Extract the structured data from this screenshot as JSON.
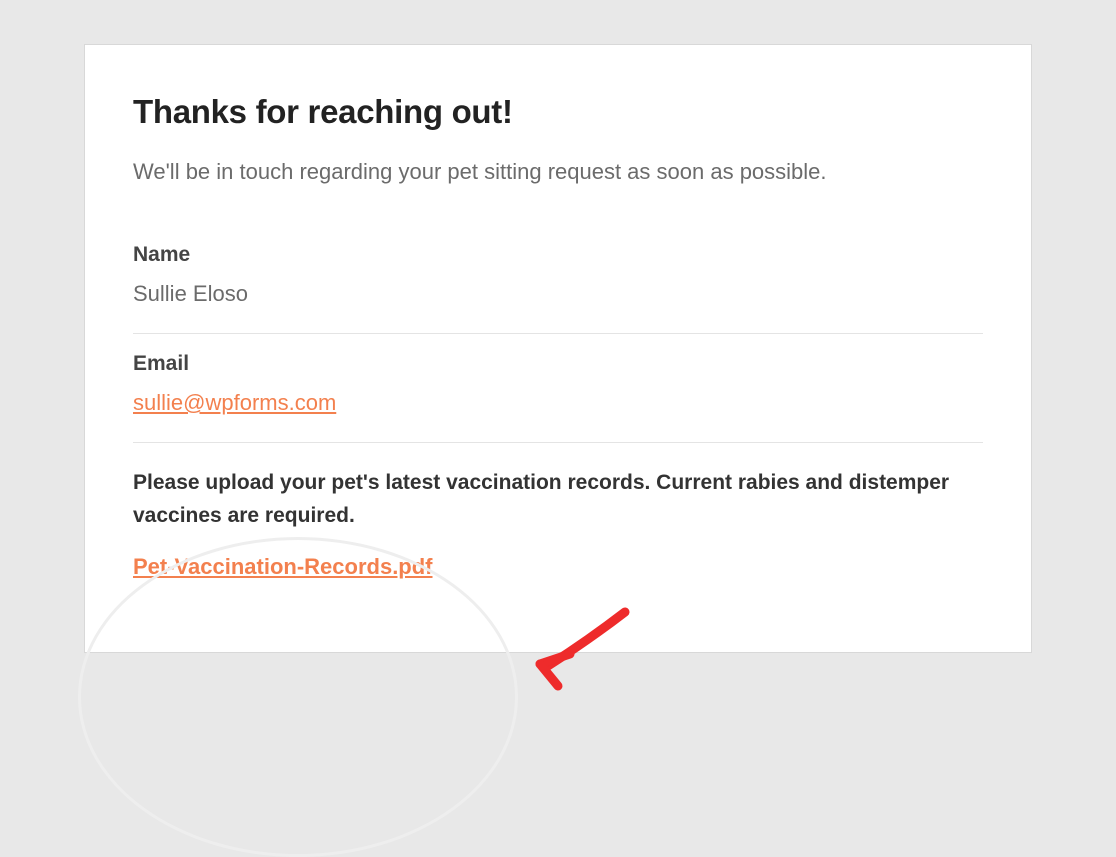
{
  "heading": "Thanks for reaching out!",
  "intro": "We'll be in touch regarding your pet sitting request as soon as possible.",
  "fields": {
    "name": {
      "label": "Name",
      "value": "Sullie Eloso"
    },
    "email": {
      "label": "Email",
      "value": "sullie@wpforms.com"
    },
    "upload": {
      "label": "Please upload your pet's latest vaccination records. Current rabies and distemper vaccines are required.",
      "filename": "Pet-Vaccination-Records.pdf"
    }
  },
  "colors": {
    "link": "#f3804e",
    "arrow": "#ee2b2b"
  }
}
